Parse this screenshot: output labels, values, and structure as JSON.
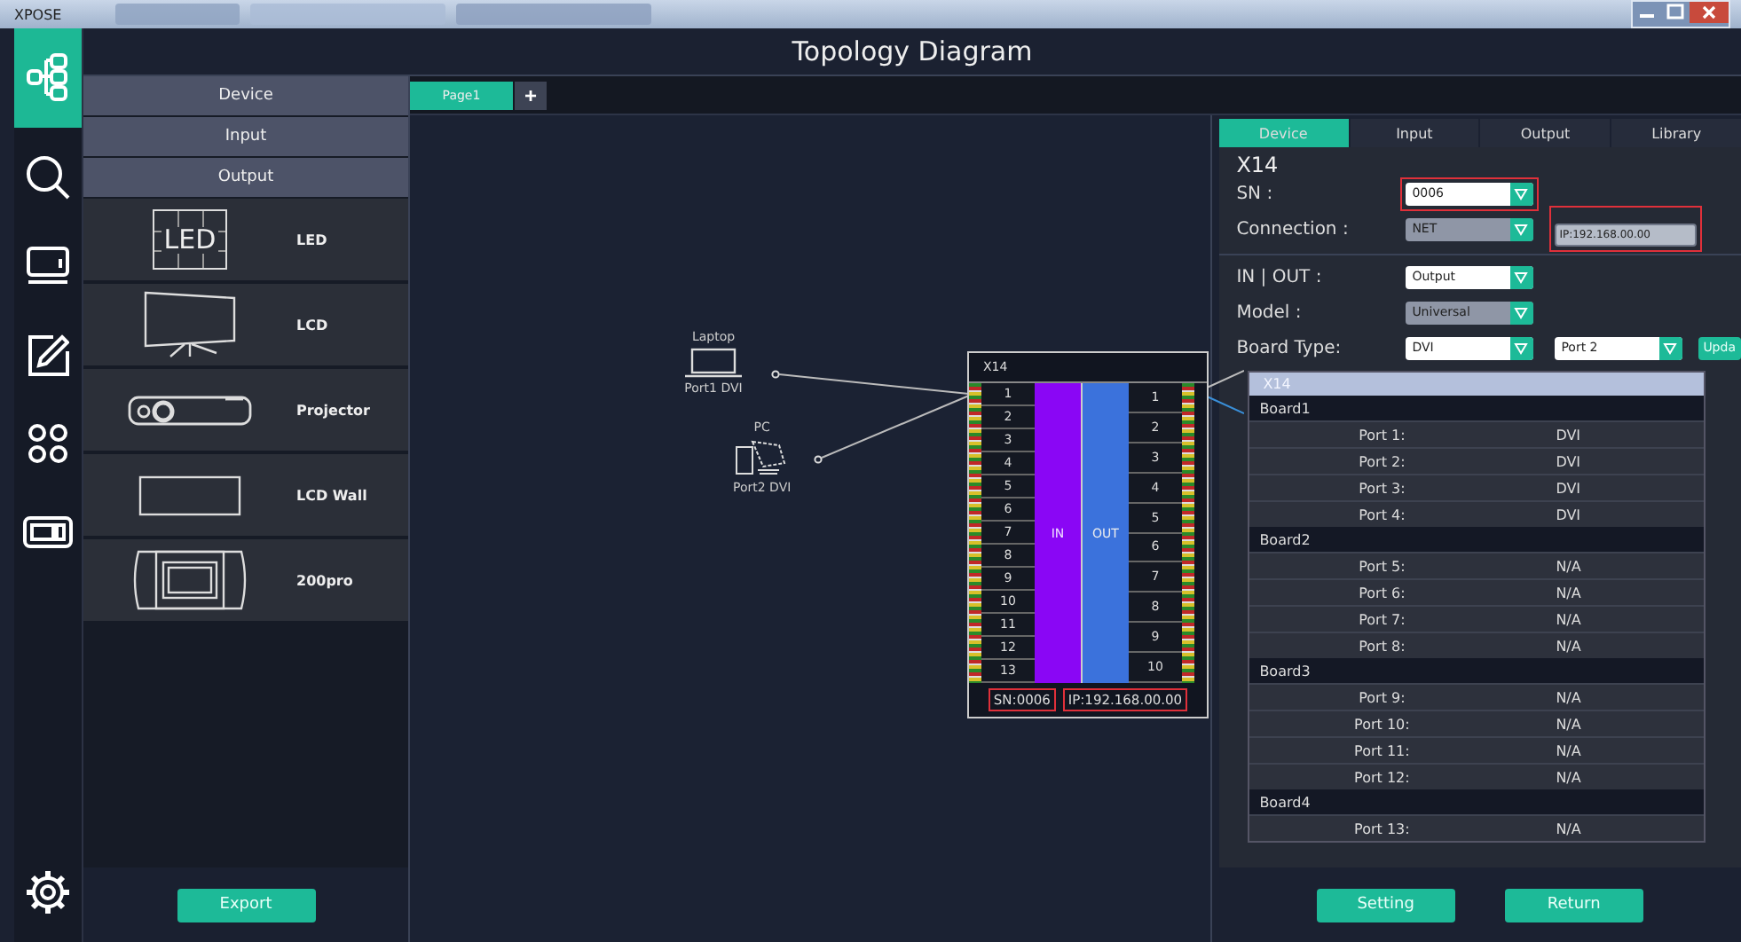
{
  "os_bar": {
    "app_name": "XPOSE"
  },
  "window": {
    "title": "Topology Diagram"
  },
  "rail": [
    {
      "kind": "topology",
      "selected": true
    },
    {
      "kind": "search",
      "selected": false
    },
    {
      "kind": "monitor",
      "selected": false
    },
    {
      "kind": "edit",
      "selected": false
    },
    {
      "kind": "grid",
      "selected": false
    },
    {
      "kind": "device",
      "selected": false
    },
    {
      "kind": "settings",
      "selected": false
    }
  ],
  "left_panel": {
    "categories": [
      "Device",
      "Input",
      "Output"
    ],
    "items": [
      {
        "kind": "led",
        "label": "LED",
        "icon_text": "LED"
      },
      {
        "kind": "lcd",
        "label": "LCD"
      },
      {
        "kind": "projector",
        "label": "Projector"
      },
      {
        "kind": "wall",
        "label": "LCD Wall"
      },
      {
        "kind": "pro",
        "label": "200pro"
      }
    ],
    "export_button": "Export"
  },
  "canvas": {
    "tabs": [
      {
        "label": "Page1",
        "selected": true
      }
    ],
    "add_tab": "+",
    "sources": [
      {
        "kind": "laptop",
        "name": "Laptop",
        "port": "Port1 DVI"
      },
      {
        "kind": "pc",
        "name": "PC",
        "port": "Port2 DVI"
      }
    ],
    "device_node": {
      "title": "X14",
      "inputs": [
        "1",
        "2",
        "3",
        "4",
        "5",
        "6",
        "7",
        "8",
        "9",
        "10",
        "11",
        "12",
        "13"
      ],
      "outputs": [
        "1",
        "2",
        "3",
        "4",
        "5",
        "6",
        "7",
        "8",
        "9",
        "10"
      ],
      "in_label": "IN",
      "out_label": "OUT",
      "sn": "SN:0006",
      "ip": "IP:192.168.00.00",
      "sn_highlighted": true,
      "ip_highlighted": true
    }
  },
  "properties": {
    "tabs": [
      {
        "label": "Device",
        "selected": true
      },
      {
        "label": "Input",
        "selected": false
      },
      {
        "label": "Output",
        "selected": false
      },
      {
        "label": "Library",
        "selected": false
      }
    ],
    "device_name": "X14",
    "sn": {
      "label": "SN :",
      "value": "0006",
      "disabled": false,
      "highlighted": true
    },
    "connection": {
      "label": "Connection :",
      "value": "NET",
      "disabled": true,
      "highlighted": false
    },
    "ip_field": {
      "value": "IP:192.168.00.00",
      "highlighted": true
    },
    "in_out": {
      "label": "IN | OUT :",
      "value": "Output",
      "disabled": false,
      "highlighted": false
    },
    "model": {
      "label": "Model :",
      "value": "Universal",
      "disabled": true,
      "highlighted": false
    },
    "board_type": {
      "label": "Board Type:",
      "value": "DVI",
      "port_value": "Port 2",
      "update_button": "Upda"
    },
    "board_list": {
      "title": "X14",
      "groups": [
        {
          "name": "Board1",
          "ports": [
            {
              "name": "Port 1:",
              "value": "DVI"
            },
            {
              "name": "Port 2:",
              "value": "DVI"
            },
            {
              "name": "Port 3:",
              "value": "DVI"
            },
            {
              "name": "Port 4:",
              "value": "DVI"
            }
          ]
        },
        {
          "name": "Board2",
          "ports": [
            {
              "name": "Port 5:",
              "value": "N/A"
            },
            {
              "name": "Port 6:",
              "value": "N/A"
            },
            {
              "name": "Port 7:",
              "value": "N/A"
            },
            {
              "name": "Port 8:",
              "value": "N/A"
            }
          ]
        },
        {
          "name": "Board3",
          "ports": [
            {
              "name": "Port 9:",
              "value": "N/A"
            },
            {
              "name": "Port 10:",
              "value": "N/A"
            },
            {
              "name": "Port 11:",
              "value": "N/A"
            },
            {
              "name": "Port 12:",
              "value": "N/A"
            }
          ]
        },
        {
          "name": "Board4",
          "ports": [
            {
              "name": "Port 13:",
              "value": "N/A"
            }
          ]
        }
      ]
    },
    "buttons": [
      "Setting",
      "Return"
    ]
  }
}
